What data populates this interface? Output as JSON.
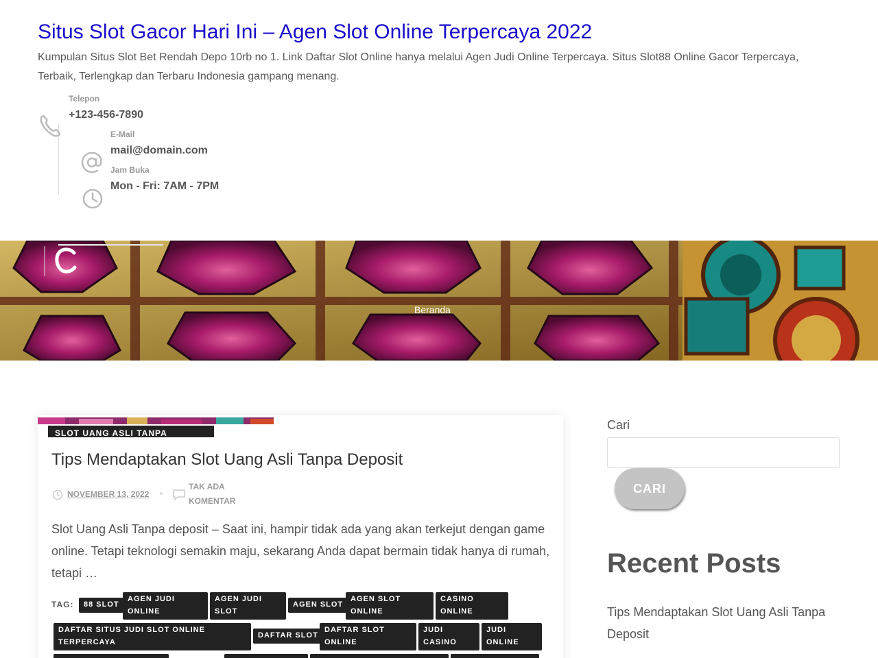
{
  "header": {
    "site_title": "Situs Slot Gacor Hari Ini – Agen Slot Online Terpercaya 2022",
    "site_description": "Kumpulan Situs Slot Bet Rendah Depo 10rb no 1. Link Daftar Slot Online hanya melalui Agen Judi Online Terpercaya. Situs Slot88 Online Gacor Terpercaya, Terbaik, Terlengkap dan Terbaru Indonesia gampang menang.",
    "contact": [
      {
        "label": "Telepon",
        "value": "+123-456-7890",
        "icon": "phone-icon"
      },
      {
        "label": "E-Mail",
        "value": "mail@domain.com",
        "icon": "at-icon"
      },
      {
        "label": "Jam Buka",
        "value": "Mon - Fri: 7AM - 7PM",
        "icon": "clock-icon"
      }
    ]
  },
  "banner": {
    "logo_letter": "C",
    "breadcrumb": "Beranda"
  },
  "post": {
    "category": "SLOT UANG ASLI TANPA",
    "title": "Tips Mendaptakan Slot Uang Asli Tanpa Deposit",
    "date": "NOVEMBER 13, 2022",
    "comments": "TAK ADA KOMENTAR",
    "excerpt": "Slot Uang Asli Tanpa deposit –  Saat ini, hampir tidak ada yang akan terkejut dengan game online. Tetapi teknologi semakin maju, sekarang Anda dapat bermain tidak hanya di rumah, tetapi …",
    "tags_label": "TAG:",
    "tags": [
      "88 SLOT",
      "AGEN JUDI ONLINE",
      "AGEN JUDI SLOT",
      "AGEN SLOT",
      "AGEN SLOT ONLINE",
      "CASINO ONLINE",
      "DAFTAR SITUS JUDI SLOT ONLINE TERPERCAYA",
      "DAFTAR SLOT",
      "DAFTAR SLOT ONLINE",
      "JUDI CASINO",
      "JUDI ONLINE"
    ]
  },
  "sidebar": {
    "search_label": "Cari",
    "search_placeholder": "",
    "search_button": "CARI",
    "recent_posts_title": "Recent Posts",
    "recent_posts": [
      "Tips Mendaptakan Slot Uang Asli Tanpa Deposit"
    ]
  },
  "colors": {
    "title_link": "#1a0dcc",
    "tag_bg": "#222222",
    "button_bg": "#c4c4c4"
  }
}
